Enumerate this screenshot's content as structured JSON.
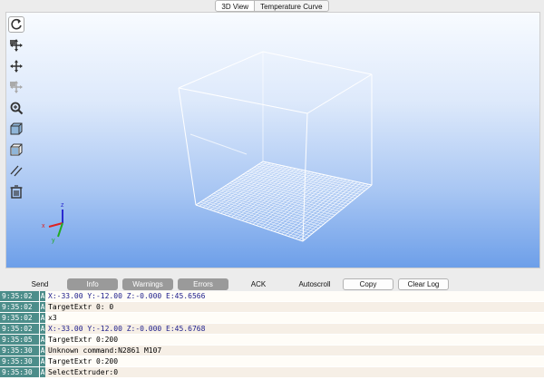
{
  "tabs": [
    {
      "label": "3D View",
      "active": true
    },
    {
      "label": "Temperature Curve",
      "active": false
    }
  ],
  "toolbar": {
    "icons": [
      "refresh-icon",
      "move-view-icon",
      "move-object-icon",
      "rotate-icon",
      "zoom-icon",
      "front-view-icon",
      "top-view-icon",
      "parallel-view-icon",
      "trash-icon"
    ]
  },
  "axes": {
    "x": "x",
    "y": "y",
    "z": "z"
  },
  "logbar": {
    "send": "Send",
    "info": "Info",
    "warnings": "Warnings",
    "errors": "Errors",
    "ack": "ACK",
    "autoscroll": "Autoscroll",
    "copy": "Copy",
    "clear_log": "Clear Log"
  },
  "log": [
    {
      "time": "9:35:02",
      "level": "A",
      "text": "X:-33.00 Y:-12.00 Z:-0.000 E:45.6566",
      "blue": true
    },
    {
      "time": "9:35:02",
      "level": "A",
      "text": "TargetExtr 0: 0",
      "blue": false
    },
    {
      "time": "9:35:02",
      "level": "A",
      "text": "x3",
      "blue": false
    },
    {
      "time": "9:35:02",
      "level": "A",
      "text": "X:-33.00 Y:-12.00 Z:-0.000 E:45.6768",
      "blue": true
    },
    {
      "time": "9:35:05",
      "level": "A",
      "text": "TargetExtr 0:200",
      "blue": false
    },
    {
      "time": "9:35:30",
      "level": "A",
      "text": "Unknown command:N2861 M107",
      "blue": false
    },
    {
      "time": "9:35:30",
      "level": "A",
      "text": "TargetExtr 0:200",
      "blue": false
    },
    {
      "time": "9:35:30",
      "level": "A",
      "text": "SelectExtruder:0",
      "blue": false
    }
  ],
  "colors": {
    "accent": "#4c8d8a",
    "toggle_grey": "#9a9a9a",
    "bed_grid": "#ffffff"
  }
}
